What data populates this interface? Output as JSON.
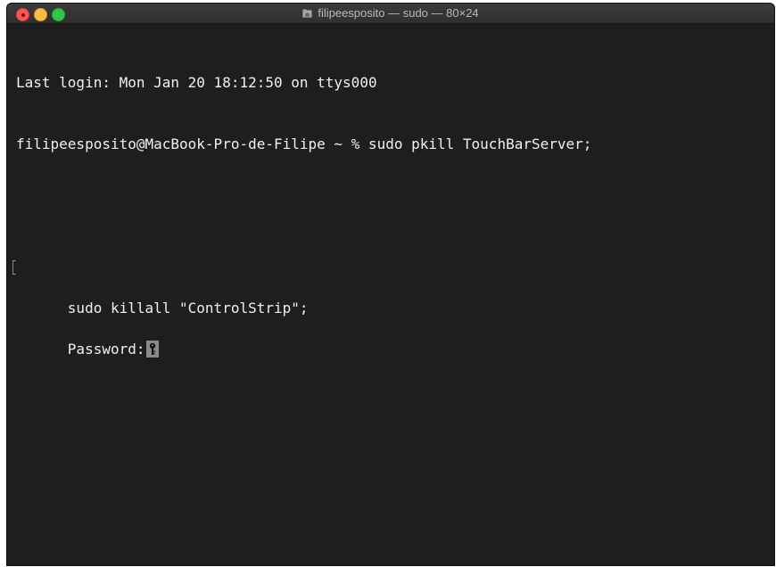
{
  "window": {
    "title": "filipeesposito — sudo — 80×24"
  },
  "terminal": {
    "lines": [
      "Last login: Mon Jan 20 18:12:50 on ttys000",
      "filipeesposito@MacBook-Pro-de-Filipe ~ % sudo pkill TouchBarServer;",
      "",
      "sudo killall \"ControlStrip\";",
      "Password:"
    ]
  },
  "icons": {
    "title_icon": "home-folder-icon",
    "cursor": "key-cursor-icon"
  },
  "colors": {
    "background": "#1e1e1e",
    "text": "#f0f0f0",
    "close": "#fc5753",
    "minimize": "#fdbc40",
    "zoom": "#33c748"
  }
}
